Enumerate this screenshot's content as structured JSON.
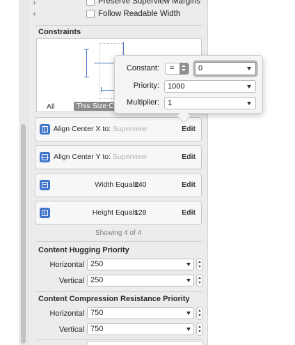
{
  "top_options": {
    "preserve_superview_margins": "Preserve Superview Margins",
    "follow_readable_width": "Follow Readable Width",
    "plus_symbol": "+"
  },
  "constraints": {
    "section_title": "Constraints",
    "scope_all": "All",
    "scope_this_size_class": "This Size Class",
    "items": [
      {
        "label": "Align Center X to:",
        "target": "Superview",
        "value": "",
        "edit": "Edit",
        "icon": "align-center-x-icon"
      },
      {
        "label": "Align Center Y to:",
        "target": "Superview",
        "value": "",
        "edit": "Edit",
        "icon": "align-center-y-icon"
      },
      {
        "label": "Width Equals:",
        "target": "",
        "value": "240",
        "edit": "Edit",
        "icon": "width-icon"
      },
      {
        "label": "Height Equals:",
        "target": "",
        "value": "128",
        "edit": "Edit",
        "icon": "height-icon"
      }
    ],
    "showing": "Showing 4 of 4"
  },
  "content_hugging": {
    "title": "Content Hugging Priority",
    "horizontal_label": "Horizontal",
    "horizontal_value": "250",
    "vertical_label": "Vertical",
    "vertical_value": "250"
  },
  "compression_resistance": {
    "title": "Content Compression Resistance Priority",
    "horizontal_label": "Horizontal",
    "horizontal_value": "750",
    "vertical_label": "Vertical",
    "vertical_value": "750"
  },
  "popover": {
    "constant_label": "Constant:",
    "relation_value": "=",
    "constant_value": "0",
    "priority_label": "Priority:",
    "priority_value": "1000",
    "multiplier_label": "Multiplier:",
    "multiplier_value": "1"
  },
  "colors": {
    "accent": "#3d73c9",
    "panel_bg": "#ececec"
  }
}
